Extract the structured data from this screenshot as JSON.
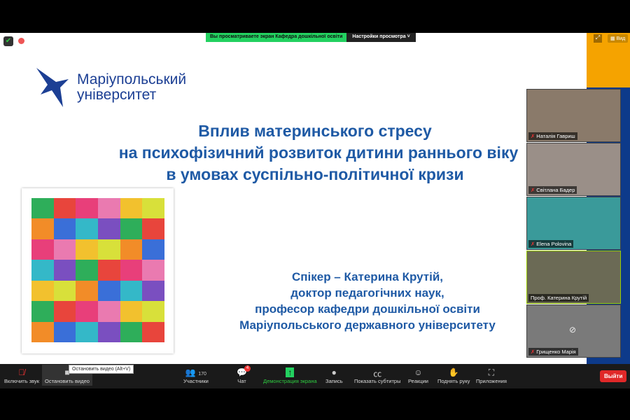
{
  "topbar": {
    "share_notice": "Вы просматриваете экран Кафедра дошкільної освіти",
    "view_settings": "Настройки просмотра",
    "view_button": "Вид"
  },
  "slide": {
    "logo_line1": "Маріупольський",
    "logo_line2": "університет",
    "title": [
      "Вплив материнського стресу",
      "на  психофізичний розвиток дитини раннього віку",
      "в умовах суспільно-політичної кризи"
    ],
    "speaker": [
      "Спікер – Катерина Крутій,",
      "доктор педагогічних наук,",
      "професор кафедри дошкільної освіти",
      "Маріупольського державного університету"
    ]
  },
  "participants": [
    {
      "name": "Наталія Гавриш",
      "muted": true,
      "bg": "#8a7a6a"
    },
    {
      "name": "Світлана Бадер",
      "muted": true,
      "bg": "#9a8f88"
    },
    {
      "name": "Elena Polovina",
      "muted": true,
      "bg": "#3a9a9a"
    },
    {
      "name": "Проф. Катерина Крутій",
      "muted": false,
      "bg": "#6b6a55"
    },
    {
      "name": "Грищенко Марія",
      "muted": true,
      "bg": "#7a7a7a"
    }
  ],
  "toolbar": {
    "unmute": "Включить звук",
    "stop_video": "Остановить видео",
    "tooltip": "Остановить видео (Alt+V)",
    "participants": "Участники",
    "participants_count": "170",
    "chat": "Чат",
    "chat_badge": "4",
    "share": "Демонстрация экрана",
    "record": "Запись",
    "captions": "Показать субтитры",
    "reactions": "Реакции",
    "raise_hand": "Поднять руку",
    "apps": "Приложения",
    "leave": "Выйти"
  }
}
